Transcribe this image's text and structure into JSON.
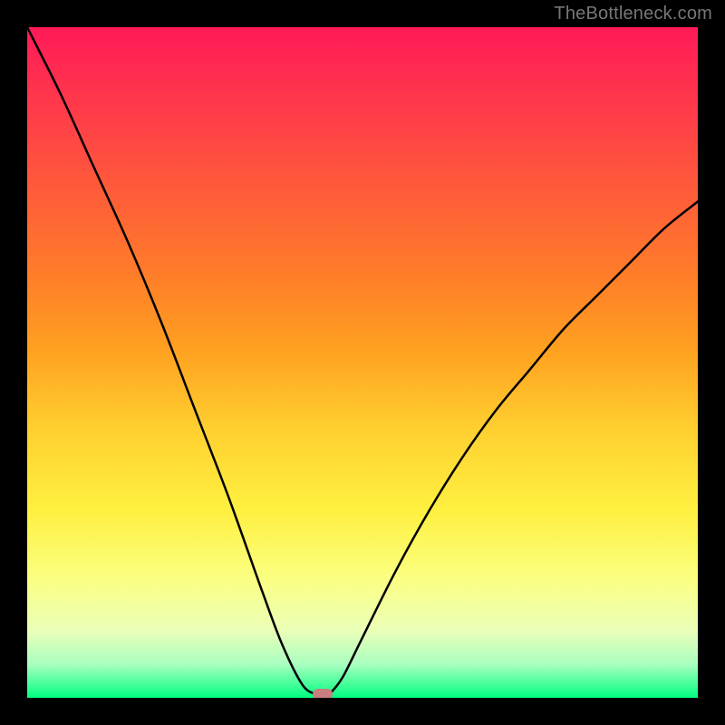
{
  "watermark": "TheBottleneck.com",
  "chart_data": {
    "type": "line",
    "title": "",
    "xlabel": "",
    "ylabel": "",
    "xlim": [
      0,
      100
    ],
    "ylim": [
      0,
      100
    ],
    "grid": false,
    "x": [
      0,
      5,
      10,
      15,
      20,
      25,
      30,
      35,
      38,
      41,
      43,
      44,
      45,
      47,
      50,
      55,
      60,
      65,
      70,
      75,
      80,
      85,
      90,
      95,
      100
    ],
    "y": [
      100,
      90,
      79,
      68,
      56,
      43,
      30,
      16,
      8,
      2,
      0.5,
      0,
      0.5,
      3,
      9,
      19,
      28,
      36,
      43,
      49,
      55,
      60,
      65,
      70,
      74
    ],
    "curve_minimum_x": 44,
    "curve_minimum_y": 0,
    "marker": {
      "x": 44,
      "y": 0
    },
    "background_gradient": [
      "#ff1a58",
      "#ffd030",
      "#fff040",
      "#00ff80"
    ]
  }
}
